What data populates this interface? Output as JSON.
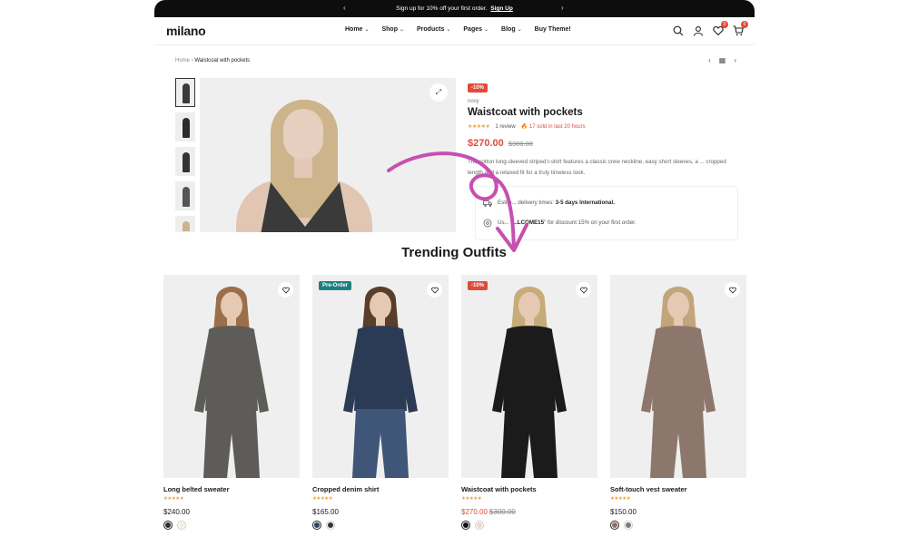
{
  "announcement": {
    "text": "Sign up for 10% off your first order.",
    "link": "Sign Up"
  },
  "header": {
    "logo": "milano",
    "nav": [
      {
        "label": "Home",
        "dropdown": true
      },
      {
        "label": "Shop",
        "dropdown": true
      },
      {
        "label": "Products",
        "dropdown": true
      },
      {
        "label": "Pages",
        "dropdown": true
      },
      {
        "label": "Blog",
        "dropdown": true
      },
      {
        "label": "Buy Theme!",
        "dropdown": false
      }
    ],
    "icons": [
      "search-icon",
      "user-icon",
      "heart-icon",
      "cart-icon"
    ],
    "wishlist_count": "0",
    "cart_count": "0"
  },
  "breadcrumb": {
    "home": "Home",
    "separator": "›",
    "current": "Waistcoat with pockets"
  },
  "product": {
    "discount": "-10%",
    "vendor": "novy",
    "title": "Waistcoat with pockets",
    "stars": "★★★★★",
    "reviews": "1 review",
    "sold": "17 sold in last 20 hours",
    "price": "$270.00",
    "compare_price": "$300.00",
    "description": "The cotton long-sleeved striped t-shirt features a classic crew neckline, easy short sleeves, a ... cropped length and a relaxed fit for a truly timeless look.",
    "delivery_prefix": "Estim... delivery times: ",
    "delivery_value": "3-5 days International.",
    "coupon_prefix": "Us... \"",
    "coupon_code": "...LCOME15",
    "coupon_suffix": "\" for discount 15% on your first order."
  },
  "section": {
    "title": "Trending Outfits"
  },
  "cards": [
    {
      "name": "Long belted sweater",
      "stars": "★★★★★",
      "price": "$240.00",
      "compare": "",
      "tag": "",
      "tag_type": "",
      "swatches": [
        "#2e2e2e",
        "#f3efd8"
      ],
      "outfit": "#5d5c58",
      "pants": "#5d5c58",
      "hair": "#9a6f49"
    },
    {
      "name": "Cropped denim shirt",
      "stars": "★★★★★",
      "price": "$165.00",
      "compare": "",
      "tag": "Pre-Order",
      "tag_type": "pre",
      "swatches": [
        "#2f4460",
        "#333333"
      ],
      "outfit": "#2c3b55",
      "pants": "#3f5678",
      "hair": "#5a3d2b"
    },
    {
      "name": "Waistcoat with pockets",
      "stars": "★★★★★",
      "price": "$270.00",
      "compare": "$300.00",
      "tag": "-10%",
      "tag_type": "sale",
      "swatches": [
        "#111111",
        "#e8d9c8"
      ],
      "outfit": "#1b1b1b",
      "pants": "#1b1b1b",
      "hair": "#c7ab78"
    },
    {
      "name": "Soft-touch vest sweater",
      "stars": "★★★★★",
      "price": "$150.00",
      "compare": "",
      "tag": "",
      "tag_type": "",
      "swatches": [
        "#8a7268",
        "#7a7a7a"
      ],
      "outfit": "#8d776d",
      "pants": "#8d776d",
      "hair": "#c2a57a"
    }
  ]
}
